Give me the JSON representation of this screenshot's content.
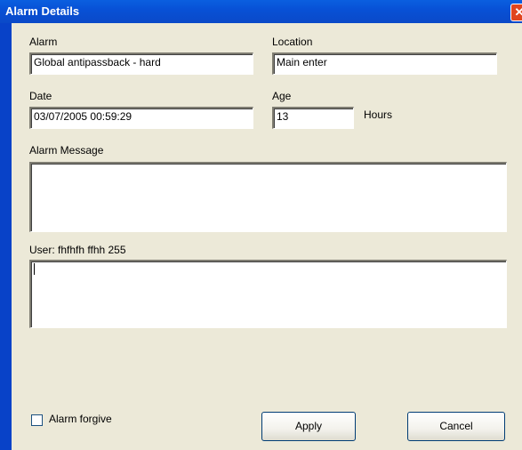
{
  "window": {
    "title": "Alarm Details",
    "close_symbol": "✕"
  },
  "form": {
    "alarm_label": "Alarm",
    "alarm_value": "Global antipassback - hard",
    "location_label": "Location",
    "location_value": "Main enter",
    "date_label": "Date",
    "date_value": "03/07/2005 00:59:29",
    "age_label": "Age",
    "age_value": "13",
    "age_unit": "Hours",
    "message_label": "Alarm Message",
    "message_value": "",
    "user_label": "User: fhfhfh ffhh 255",
    "user_value": ""
  },
  "footer": {
    "forgive_label": "Alarm forgive",
    "forgive_checked": false,
    "apply_label": "Apply",
    "cancel_label": "Cancel"
  },
  "colors": {
    "titlebar": "#0851d6",
    "client": "#ece9d8",
    "close": "#e0451f"
  }
}
